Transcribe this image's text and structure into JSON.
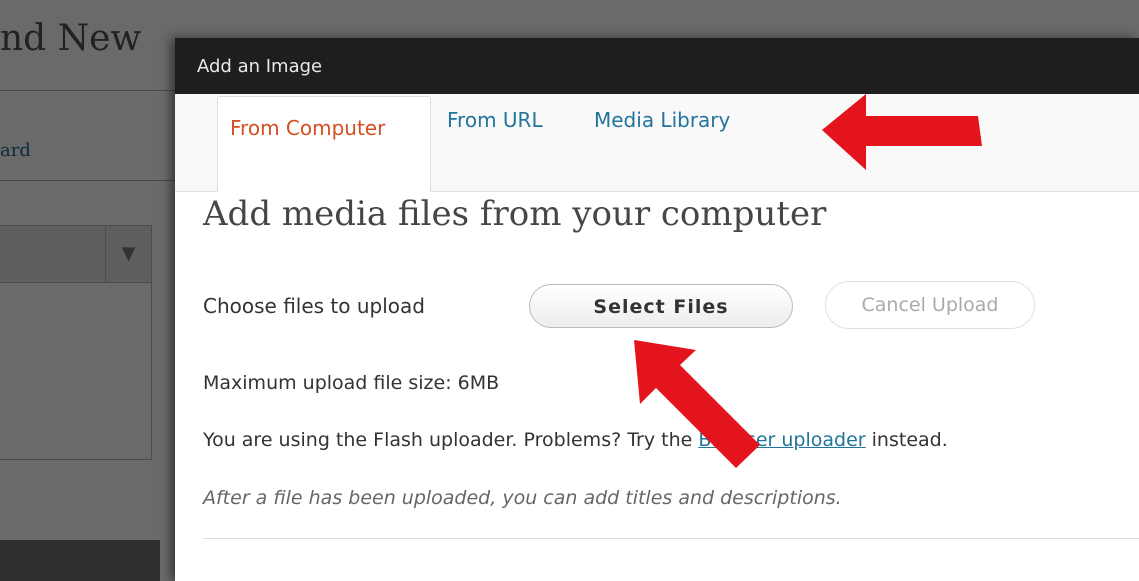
{
  "background": {
    "page_title_fragment": "nd New",
    "link_fragment": "ard",
    "select_arrow": "▼"
  },
  "modal": {
    "title": "Add an Image",
    "tabs": [
      {
        "label": "From Computer",
        "active": true
      },
      {
        "label": "From URL",
        "active": false
      },
      {
        "label": "Media Library",
        "active": false
      }
    ],
    "heading": "Add media files from your computer",
    "choose_label": "Choose files to upload",
    "select_button": "Select Files",
    "cancel_button": "Cancel Upload",
    "max_size": "Maximum upload file size: 6MB",
    "flash_prefix": "You are using the Flash uploader. Problems? Try the",
    "browser_uploader_link": "Browser uploader",
    "flash_suffix": "instead.",
    "after_upload_note": "After a file has been uploaded, you can add titles and descriptions."
  },
  "annotations": {
    "arrow_color": "#e3141b",
    "arrows": [
      "red-arrow-pointing-to-tabs",
      "red-arrow-pointing-to-select-files"
    ]
  },
  "colors": {
    "tab_link": "#21759b",
    "tab_active": "#d54e21",
    "titlebar": "#1e1e1e"
  }
}
